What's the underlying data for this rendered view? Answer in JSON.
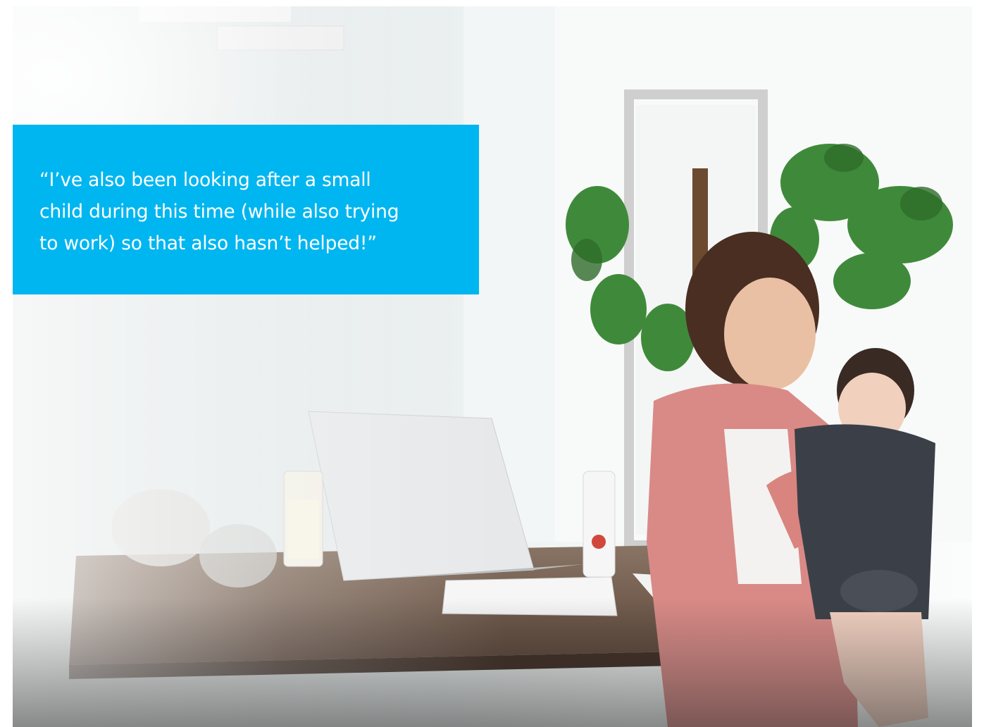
{
  "quote": {
    "text": "“I’ve also been looking after a small\nchild during this time (while also trying\nto work) so that also hasn’t helped!”",
    "background_color": "#00b6f0",
    "text_color": "#ffffff"
  },
  "photo": {
    "subject": "woman-holding-baby-at-home-desk-with-laptop-icon"
  }
}
